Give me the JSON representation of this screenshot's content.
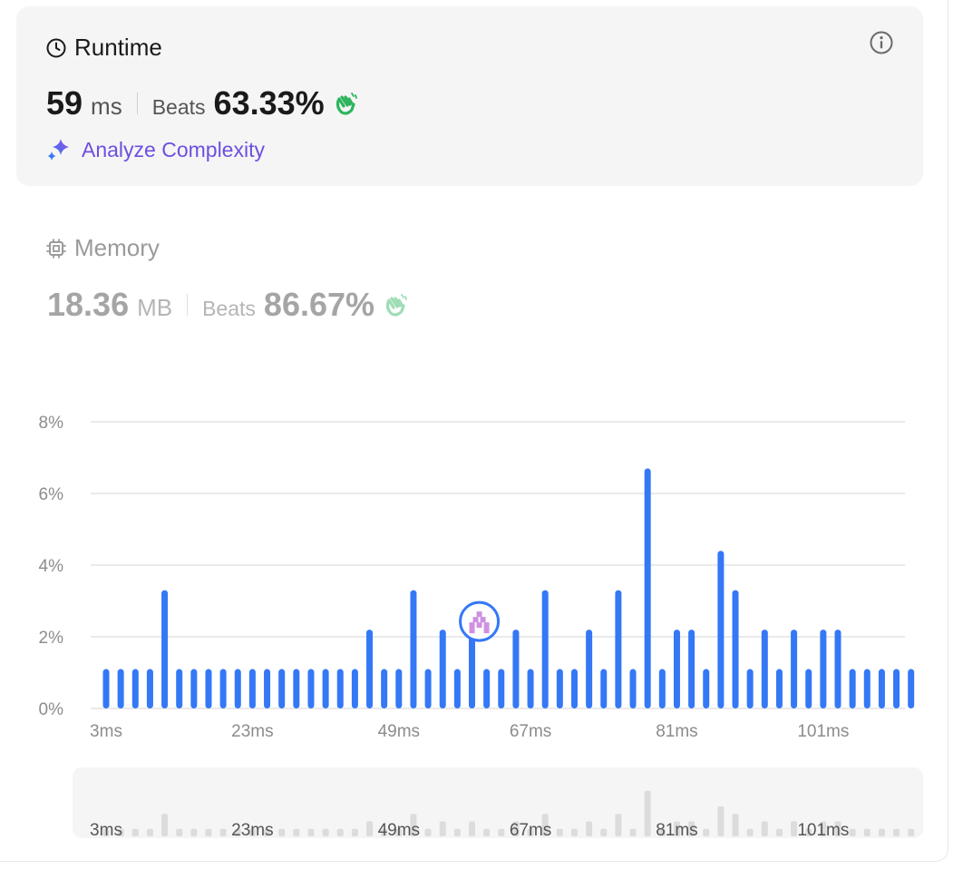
{
  "runtime": {
    "title": "Runtime",
    "value": "59",
    "unit": "ms",
    "beats_label": "Beats",
    "beats_value": "63.33%",
    "analyze_label": "Analyze Complexity"
  },
  "memory": {
    "title": "Memory",
    "value": "18.36",
    "unit": "MB",
    "beats_label": "Beats",
    "beats_value": "86.67%"
  },
  "colors": {
    "bar": "#3478f6",
    "accent_purple": "#6e4fe0",
    "clap_green": "#2db55d",
    "marker_pink": "#c77dd9"
  },
  "icons": {
    "runtime": "clock-icon",
    "info": "info-icon",
    "analyze": "sparkle-icon",
    "memory": "chip-icon",
    "beats": "clapping-hands-icon",
    "you_marker": "avatar-icon"
  },
  "chart_data": {
    "type": "bar",
    "y_unit": "%",
    "ylim": [
      0,
      8
    ],
    "yticks": [
      "0%",
      "2%",
      "4%",
      "6%",
      "8%"
    ],
    "xtick_labels": [
      "3ms",
      "23ms",
      "49ms",
      "67ms",
      "81ms",
      "101ms"
    ],
    "grid": true,
    "highlight_index": 26,
    "highlight_value": "59ms",
    "values": [
      1.1,
      1.1,
      1.1,
      1.1,
      3.3,
      1.1,
      1.1,
      1.1,
      1.1,
      1.1,
      1.1,
      1.1,
      1.1,
      1.1,
      1.1,
      1.1,
      1.1,
      1.1,
      2.2,
      1.1,
      1.1,
      3.3,
      1.1,
      2.2,
      1.1,
      2.2,
      1.1,
      1.1,
      2.2,
      1.1,
      3.3,
      1.1,
      1.1,
      2.2,
      1.1,
      3.3,
      1.1,
      6.7,
      1.1,
      2.2,
      2.2,
      1.1,
      4.4,
      3.3,
      1.1,
      2.2,
      1.1,
      2.2,
      1.1,
      2.2,
      2.2,
      1.1,
      1.1,
      1.1,
      1.1,
      1.1
    ]
  }
}
